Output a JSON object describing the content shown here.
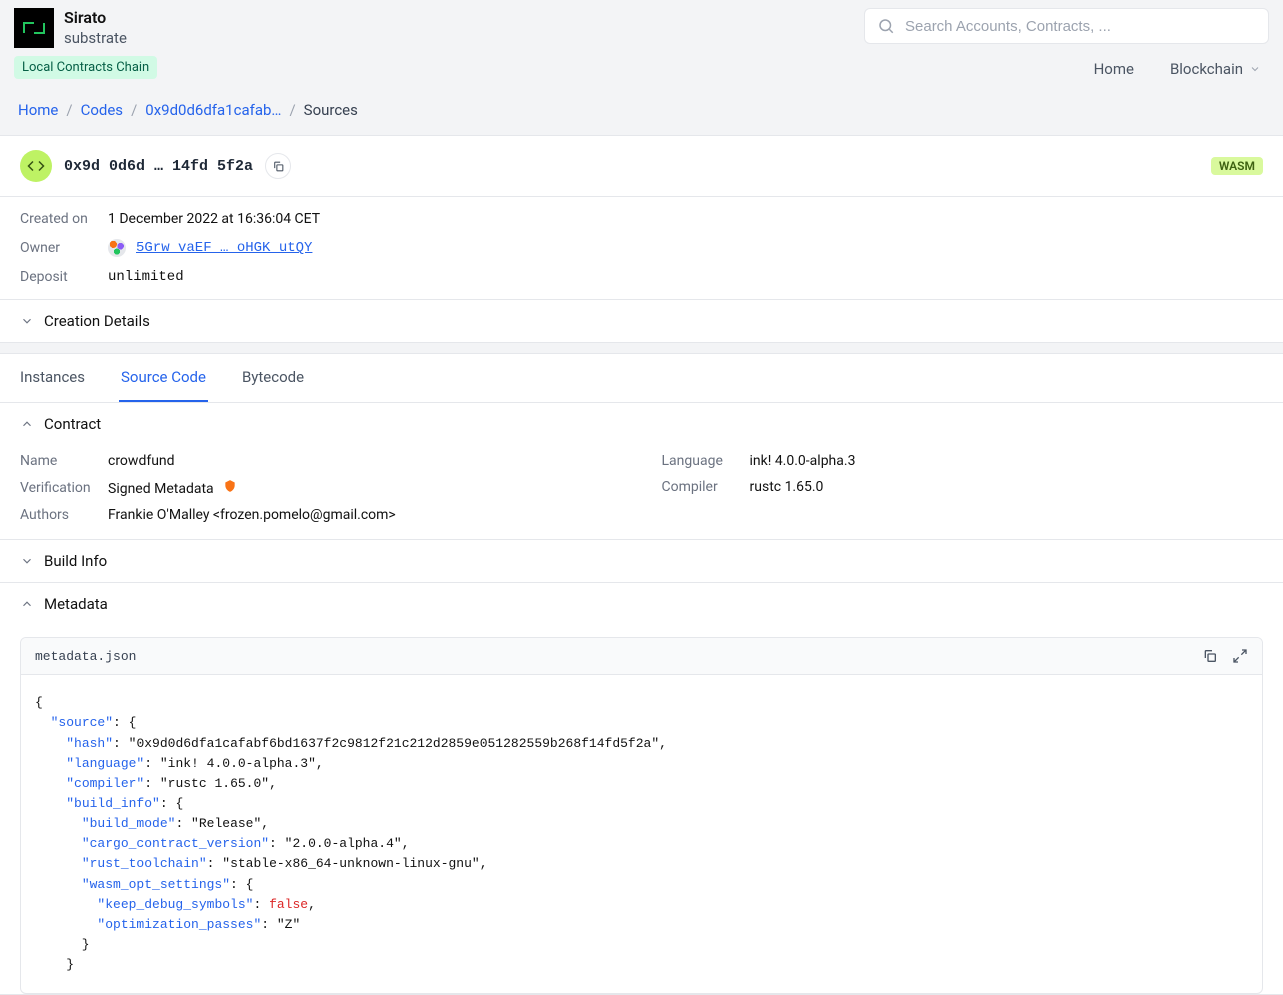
{
  "brand": {
    "title": "Sirato",
    "subtitle": "substrate"
  },
  "chainBadge": "Local Contracts Chain",
  "search": {
    "placeholder": "Search Accounts, Contracts, ..."
  },
  "nav": {
    "home": "Home",
    "blockchain": "Blockchain"
  },
  "breadcrumb": {
    "home": "Home",
    "codes": "Codes",
    "hash": "0x9d0d6dfa1cafab…",
    "current": "Sources"
  },
  "hashRow": {
    "hash": "0x9d 0d6d … 14fd 5f2a",
    "badge": "WASM"
  },
  "meta": {
    "createdLabel": "Created on",
    "createdValue": "1 December 2022 at 16:36:04 CET",
    "ownerLabel": "Owner",
    "ownerValue": "5Grw vaEF … oHGK utQY",
    "depositLabel": "Deposit",
    "depositValue": "unlimited"
  },
  "sections": {
    "creation": "Creation Details",
    "contract": "Contract",
    "build": "Build Info",
    "metadata": "Metadata"
  },
  "tabs": {
    "instances": "Instances",
    "source": "Source Code",
    "bytecode": "Bytecode"
  },
  "contract": {
    "nameLabel": "Name",
    "nameValue": "crowdfund",
    "verificationLabel": "Verification",
    "verificationValue": "Signed Metadata",
    "authorsLabel": "Authors",
    "authorsValue": "Frankie O'Malley <frozen.pomelo@gmail.com>",
    "languageLabel": "Language",
    "languageValue": "ink! 4.0.0-alpha.3",
    "compilerLabel": "Compiler",
    "compilerValue": "rustc 1.65.0"
  },
  "metadataFile": "metadata.json",
  "json": {
    "source_hash": "0x9d0d6dfa1cafabf6bd1637f2c9812f21c212d2859e051282559b268f14fd5f2a",
    "language": "ink! 4.0.0-alpha.3",
    "compiler": "rustc 1.65.0",
    "build_mode": "Release",
    "cargo_contract_version": "2.0.0-alpha.4",
    "rust_toolchain": "stable-x86_64-unknown-linux-gnu",
    "keep_debug_symbols": "false",
    "optimization_passes": "Z"
  }
}
